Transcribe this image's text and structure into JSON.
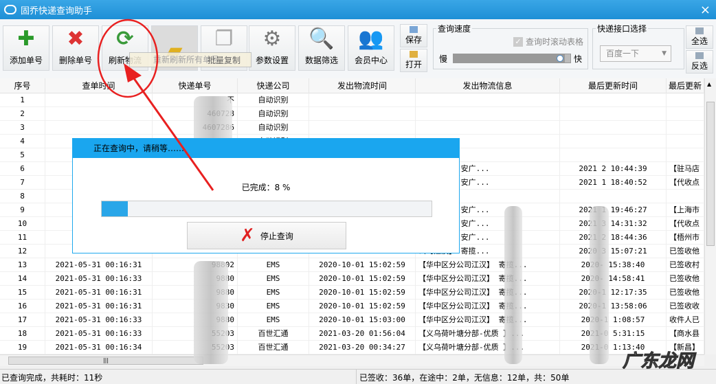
{
  "window": {
    "title": "固乔快递查询助手",
    "close": "×"
  },
  "toolbar": {
    "buttons": [
      {
        "label": "添加单号",
        "icon": "plus-icon"
      },
      {
        "label": "删除单号",
        "icon": "delete-x-icon"
      },
      {
        "label": "刷新物流",
        "icon": "refresh-icon"
      },
      {
        "label": "",
        "icon": "folder-import-icon"
      },
      {
        "label": "批量复制",
        "icon": "copy-icon"
      },
      {
        "label": "参数设置",
        "icon": "gear-icon"
      },
      {
        "label": "数据筛选",
        "icon": "search-folder-icon"
      },
      {
        "label": "会员中心",
        "icon": "users-icon"
      }
    ],
    "save": "保存",
    "open": "打开",
    "select_all": "全选",
    "invert": "反选",
    "speed_group": "查询速度",
    "scroll_checkbox": "查询时滚动表格",
    "slow": "慢",
    "fast": "快",
    "speed_value": 0.95,
    "api_group": "快递接口选择",
    "api_selected": "百度一下",
    "tooltip": "重新刷新所有单号"
  },
  "table": {
    "headers": [
      "序号",
      "查单时间",
      "快递单号",
      "快递公司",
      "发出物流时间",
      "发出物流信息",
      "最后更新时间",
      "最后更新"
    ],
    "rows": [
      [
        "1",
        "",
        "不",
        "自动识别",
        "",
        "",
        "",
        ""
      ],
      [
        "2",
        "",
        "460728",
        "自动识别",
        "",
        "",
        "",
        ""
      ],
      [
        "3",
        "",
        "4607286",
        "自动识别",
        "",
        "",
        "",
        ""
      ],
      [
        "4",
        "",
        "",
        "自动识别",
        "",
        "",
        "",
        ""
      ],
      [
        "5",
        "",
        "",
        "",
        "",
        "",
        "",
        ""
      ],
      [
        "6",
        "202",
        "",
        "",
        "",
        "北京金韵三  安广...",
        "2021  2 10:44:39",
        "【驻马店"
      ],
      [
        "7",
        "202",
        "",
        "",
        "",
        "北京金韵三  安广...",
        "2021  1 18:40:52",
        "【代收点"
      ],
      [
        "8",
        "",
        "",
        "",
        "",
        "",
        "",
        ""
      ],
      [
        "9",
        "202",
        "",
        "",
        "",
        "北京金韵三  安广...",
        "2021  1 19:46:27",
        "【上海市"
      ],
      [
        "10",
        "202",
        "",
        "",
        "",
        "北京金韵三  安广...",
        "2021  3 14:31:32",
        "【代收点"
      ],
      [
        "11",
        "202",
        "",
        "",
        "",
        "北京金韵三  安广...",
        "2021  2 18:44:36",
        "【梧州市"
      ],
      [
        "12",
        "202",
        "",
        "",
        "",
        "公司江汉】 寄揽...",
        "2020  3 15:07:21",
        "已签收他"
      ],
      [
        "13",
        "2021-05-31 00:16:31",
        "98802",
        "EMS",
        "2020-10-01 15:02:59",
        "【华中区分公司江汉】 寄揽...",
        "2020-  15:38:40",
        "已签收村"
      ],
      [
        "14",
        "2021-05-31 00:16:33",
        "9880",
        "EMS",
        "2020-10-01 15:02:59",
        "【华中区分公司江汉】 寄揽...",
        "2020-  14:58:41",
        "已签收他"
      ],
      [
        "15",
        "2021-05-31 00:16:31",
        "9880",
        "EMS",
        "2020-10-01 15:02:59",
        "【华中区分公司江汉】 寄揽...",
        "2020-1 12:17:35",
        "已签收他"
      ],
      [
        "16",
        "2021-05-31 00:16:31",
        "9830",
        "EMS",
        "2020-10-01 15:02:59",
        "【华中区分公司江汉】 寄揽...",
        "2020-1 13:58:06",
        "已签收收"
      ],
      [
        "17",
        "2021-05-31 00:16:33",
        "9880",
        "EMS",
        "2020-10-01 15:03:00",
        "【华中区分公司江汉】 寄揽...",
        "2020-1 1:08:57",
        "收件人已"
      ],
      [
        "18",
        "2021-05-31 00:16:33",
        "55203",
        "百世汇通",
        "2021-03-20 01:56:04",
        "【义乌荷叶塘分部-优质  】...",
        "2021-0  5:31:15",
        "【商水县"
      ],
      [
        "19",
        "2021-05-31 00:16:34",
        "55203",
        "百世汇通",
        "2021-03-20 00:34:27",
        "【义乌荷叶塘分部-优质  】...",
        "2021-0  1:13:40",
        "【新昌】"
      ]
    ]
  },
  "dialog": {
    "title": "正在查询中，请稍等……",
    "progress_label": "已完成：8 %",
    "progress": 0.08,
    "stop_button": "停止查询"
  },
  "status": {
    "left": "已查询完成，共耗时：11秒",
    "right": "已签收：36单，在途中：2单，无信息：12单，共：50单"
  },
  "watermark": "广东龙网"
}
